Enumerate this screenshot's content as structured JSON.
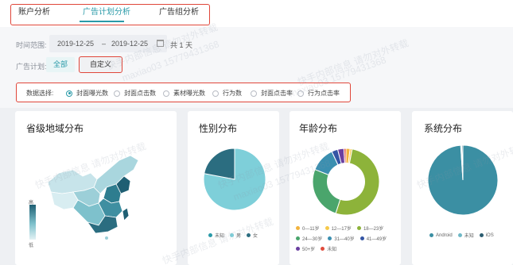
{
  "tabs": [
    {
      "label": "账户分析",
      "active": false
    },
    {
      "label": "广告计划分析",
      "active": true
    },
    {
      "label": "广告组分析",
      "active": false
    }
  ],
  "filters": {
    "time_label": "时间范围:",
    "start_date": "2019-12-25",
    "separator": "–",
    "end_date": "2019-12-25",
    "days": "共 1 天",
    "plan_label": "广告计划:",
    "btn_all": "全部",
    "btn_custom": "自定义"
  },
  "data_select": {
    "label": "数据选择:",
    "options": [
      "封面曝光数",
      "封面点击数",
      "素材曝光数",
      "行为数",
      "封面点击率",
      "行为点击率"
    ],
    "selected_index": 0
  },
  "cards": {
    "region": {
      "title": "省级地域分布",
      "scale_high": "高",
      "scale_low": "低"
    },
    "gender": {
      "title": "性别分布",
      "legend": [
        "未知",
        "男",
        "女"
      ]
    },
    "age": {
      "title": "年龄分布",
      "legend": [
        "0—11岁",
        "12—17岁",
        "18—23岁",
        "24—30岁",
        "31—40岁",
        "41—49岁",
        "50+岁",
        "未知"
      ]
    },
    "os": {
      "title": "系统分布",
      "legend": [
        "Android",
        "未知",
        "iOS"
      ]
    }
  },
  "chart_data": [
    {
      "type": "pie",
      "categories": [
        "未知",
        "男",
        "女"
      ],
      "values": [
        0,
        78,
        22
      ],
      "colors": [
        "#2a9aa8",
        "#7ecfd9",
        "#2b6d80"
      ]
    },
    {
      "type": "pie",
      "donut": true,
      "categories": [
        "0—11岁",
        "12—17岁",
        "18—23岁",
        "24—30岁",
        "31—40岁",
        "41—49岁",
        "50+岁",
        "未知"
      ],
      "values": [
        2,
        1,
        52,
        26,
        12,
        3,
        3,
        1
      ],
      "colors": [
        "#f2b33d",
        "#f6c94a",
        "#8db33a",
        "#4aa56c",
        "#3b8fb0",
        "#3455a4",
        "#6a3fa0",
        "#e04b3c"
      ]
    },
    {
      "type": "pie",
      "categories": [
        "Android",
        "未知",
        "iOS"
      ],
      "values": [
        99,
        0.5,
        0.5
      ],
      "colors": [
        "#3b8fa3",
        "#6fb8c6",
        "#2b5d70"
      ]
    }
  ],
  "watermark": {
    "text": "快手内部信息 请勿对外转载",
    "id": "maxiao03 15779431368"
  }
}
